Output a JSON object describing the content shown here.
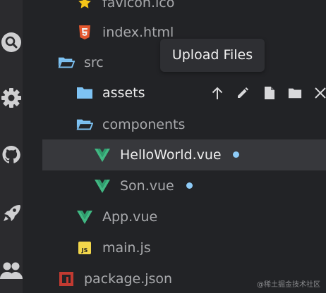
{
  "activity_bar": {
    "items": [
      {
        "icon": "search-icon"
      },
      {
        "icon": "gear-icon"
      },
      {
        "icon": "github-icon"
      },
      {
        "icon": "rocket-icon"
      },
      {
        "icon": "users-icon"
      }
    ]
  },
  "tree": [
    {
      "name": "favicon.ico",
      "type": "file",
      "icon": "star-icon"
    },
    {
      "name": "index.html",
      "type": "file",
      "icon": "html5-icon"
    },
    {
      "name": "src",
      "type": "folder-open",
      "icon": "folder-open-icon"
    },
    {
      "name": "assets",
      "type": "folder",
      "icon": "folder-icon",
      "hovered": true
    },
    {
      "name": "components",
      "type": "folder-open",
      "icon": "folder-open-icon"
    },
    {
      "name": "HelloWorld.vue",
      "type": "file",
      "icon": "vue-icon",
      "selected": true,
      "modified": true
    },
    {
      "name": "Son.vue",
      "type": "file",
      "icon": "vue-icon",
      "modified": true
    },
    {
      "name": "App.vue",
      "type": "file",
      "icon": "vue-icon"
    },
    {
      "name": "main.js",
      "type": "file",
      "icon": "js-icon",
      "badge": "JS"
    },
    {
      "name": "package.json",
      "type": "file",
      "icon": "npm-icon"
    }
  ],
  "row_actions": [
    "upload-icon",
    "edit-icon",
    "new-file-icon",
    "new-folder-icon",
    "close-icon"
  ],
  "tooltip": {
    "text": "Upload Files"
  },
  "watermark": {
    "text": "@稀土掘金技术社区"
  },
  "colors": {
    "background": "#222326",
    "activity_bar": "#2b2b2e",
    "selected_row": "#37383c",
    "folder_blue": "#7ec3f4",
    "vue_green": "#41b883",
    "modified_dot": "#8ecbf7",
    "html_orange": "#e4572e",
    "js_yellow": "#f2d64b",
    "npm_red": "#c13a31",
    "star_yellow": "#f5c518"
  }
}
